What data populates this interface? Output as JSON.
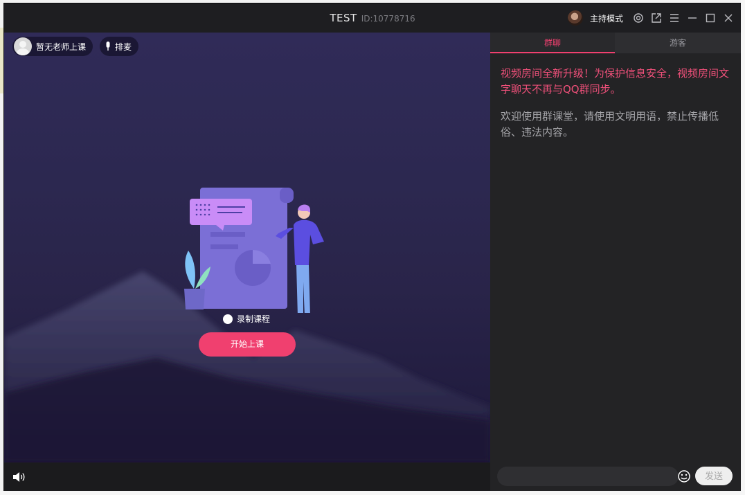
{
  "titlebar": {
    "title": "TEST",
    "room_id": "ID:10778716",
    "host_mode_label": "主持模式"
  },
  "video": {
    "teacher_status": "暂无老师上课",
    "queue_label": "排麦",
    "record_label": "录制课程",
    "start_button": "开始上课"
  },
  "chat": {
    "tabs": [
      {
        "label": "群聊",
        "active": true
      },
      {
        "label": "游客",
        "active": false
      }
    ],
    "messages": [
      {
        "text": "视频房间全新升级！为保护信息安全，视频房间文字聊天不再与QQ群同步。",
        "color": "#f0507a"
      },
      {
        "text": "欢迎使用群课堂，请使用文明用语，禁止传播低俗、违法内容。",
        "color": "#a6a6aa"
      }
    ],
    "input_placeholder": "",
    "send_label": "发送"
  },
  "colors": {
    "accent": "#f0406f",
    "chat_bg": "#232325",
    "titlebar_bg": "#1e1e21"
  },
  "icons": [
    "avatar",
    "settings-icon",
    "popout-icon",
    "menu-icon",
    "minimize-icon",
    "maximize-icon",
    "close-icon",
    "microphone-icon",
    "speaker-icon",
    "emoji-icon"
  ]
}
